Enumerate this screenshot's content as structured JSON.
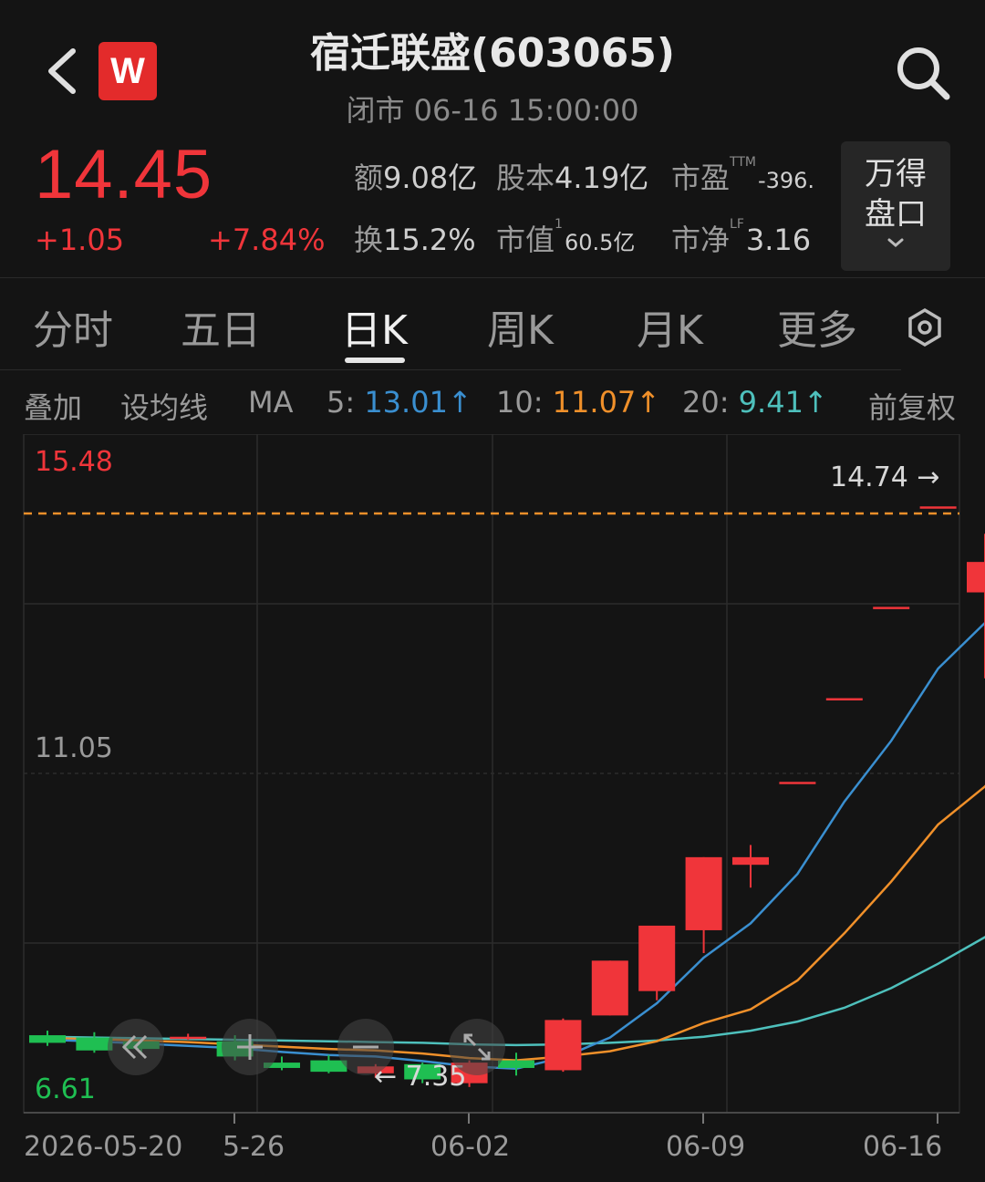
{
  "header": {
    "title": "宿迁联盛(603065)",
    "subtitle": "闭市 06-16 15:00:00",
    "logo": "W"
  },
  "quote": {
    "price": "14.45",
    "change": "+1.05",
    "change_pct": "+7.84%",
    "stats": [
      {
        "label": "额",
        "value": "9.08亿"
      },
      {
        "label": "股本",
        "value": "4.19亿"
      },
      {
        "label": "市盈",
        "sup": "TTM",
        "value": "-396."
      },
      {
        "label": "换",
        "value": "15.2%"
      },
      {
        "label": "市值",
        "sup": "1",
        "value": "60.5亿"
      },
      {
        "label": "市净",
        "sup": "LF",
        "value": "3.16"
      }
    ],
    "wande_button": [
      "万得",
      "盘口"
    ]
  },
  "tabs": [
    "分时",
    "五日",
    "日K",
    "周K",
    "月K",
    "更多"
  ],
  "active_tab": "日K",
  "ma_row": {
    "overlay": "叠加",
    "set_ma": "设均线",
    "ma": "MA",
    "ma5_label": "5:",
    "ma5_value": "13.01",
    "ma10_label": "10:",
    "ma10_value": "11.07",
    "ma20_label": "20:",
    "ma20_value": "9.41",
    "arrow": "↑",
    "adjust": "前复权"
  },
  "colors": {
    "up": "#f0353a",
    "down": "#1fbf52",
    "ma5": "#3a8fd0",
    "ma10": "#f0902a",
    "ma20": "#4ec0bc",
    "ref_line": "#f0902a"
  },
  "chart_data": {
    "type": "candlestick",
    "y_max_label": "15.48",
    "y_mid_label": "11.05",
    "y_min_label": "6.61",
    "high_marker": "14.74 →",
    "low_marker": "← 7.35",
    "ylim": [
      6.61,
      15.48
    ],
    "date_labels": [
      "2026-05-20",
      "5-26",
      "06-02",
      "06-09",
      "06-16"
    ],
    "candles": [
      {
        "o": 7.58,
        "h": 7.64,
        "l": 7.44,
        "c": 7.48
      },
      {
        "o": 7.55,
        "h": 7.62,
        "l": 7.35,
        "c": 7.38
      },
      {
        "o": 7.5,
        "h": 7.52,
        "l": 7.35,
        "c": 7.4
      },
      {
        "o": 7.54,
        "h": 7.6,
        "l": 7.52,
        "c": 7.56
      },
      {
        "o": 7.5,
        "h": 7.58,
        "l": 7.25,
        "c": 7.3
      },
      {
        "o": 7.22,
        "h": 7.3,
        "l": 7.12,
        "c": 7.15
      },
      {
        "o": 7.25,
        "h": 7.32,
        "l": 7.08,
        "c": 7.1
      },
      {
        "o": 7.08,
        "h": 7.2,
        "l": 7.02,
        "c": 7.17
      },
      {
        "o": 7.2,
        "h": 7.22,
        "l": 6.95,
        "c": 7.0
      },
      {
        "o": 6.95,
        "h": 7.25,
        "l": 6.9,
        "c": 7.22
      },
      {
        "o": 7.25,
        "h": 7.35,
        "l": 7.05,
        "c": 7.15
      },
      {
        "o": 7.12,
        "h": 7.8,
        "l": 7.1,
        "c": 7.78
      },
      {
        "o": 7.84,
        "h": 8.56,
        "l": 7.84,
        "c": 8.56
      },
      {
        "o": 8.16,
        "h": 9.02,
        "l": 8.04,
        "c": 9.02
      },
      {
        "o": 8.96,
        "h": 9.92,
        "l": 8.66,
        "c": 9.92
      },
      {
        "o": 9.82,
        "h": 10.08,
        "l": 9.52,
        "c": 9.92
      },
      {
        "o": 10.91,
        "h": 10.91,
        "l": 10.91,
        "c": 10.91
      },
      {
        "o": 12.01,
        "h": 12.01,
        "l": 12.01,
        "c": 12.01
      },
      {
        "o": 13.21,
        "h": 13.21,
        "l": 13.21,
        "c": 13.21
      },
      {
        "o": 14.53,
        "h": 14.53,
        "l": 14.53,
        "c": 14.53
      },
      {
        "o": 13.4,
        "h": 14.17,
        "l": 12.27,
        "c": 13.8
      },
      {
        "o": 13.4,
        "h": 14.74,
        "l": 13.32,
        "c": 14.45
      }
    ],
    "ma5": [
      7.52,
      7.5,
      7.47,
      7.44,
      7.41,
      7.36,
      7.32,
      7.3,
      7.24,
      7.17,
      7.14,
      7.29,
      7.55,
      8.0,
      8.6,
      9.05,
      9.7,
      10.65,
      11.45,
      12.4,
      13.0,
      13.6
    ],
    "ma10": [
      7.54,
      7.53,
      7.51,
      7.49,
      7.46,
      7.43,
      7.4,
      7.38,
      7.34,
      7.28,
      7.25,
      7.3,
      7.37,
      7.5,
      7.74,
      7.92,
      8.3,
      8.92,
      9.6,
      10.35,
      10.85,
      11.55
    ],
    "ma20": [
      7.56,
      7.55,
      7.54,
      7.53,
      7.52,
      7.51,
      7.5,
      7.49,
      7.48,
      7.46,
      7.45,
      7.46,
      7.48,
      7.51,
      7.56,
      7.64,
      7.76,
      7.94,
      8.2,
      8.52,
      8.87,
      9.3
    ]
  }
}
